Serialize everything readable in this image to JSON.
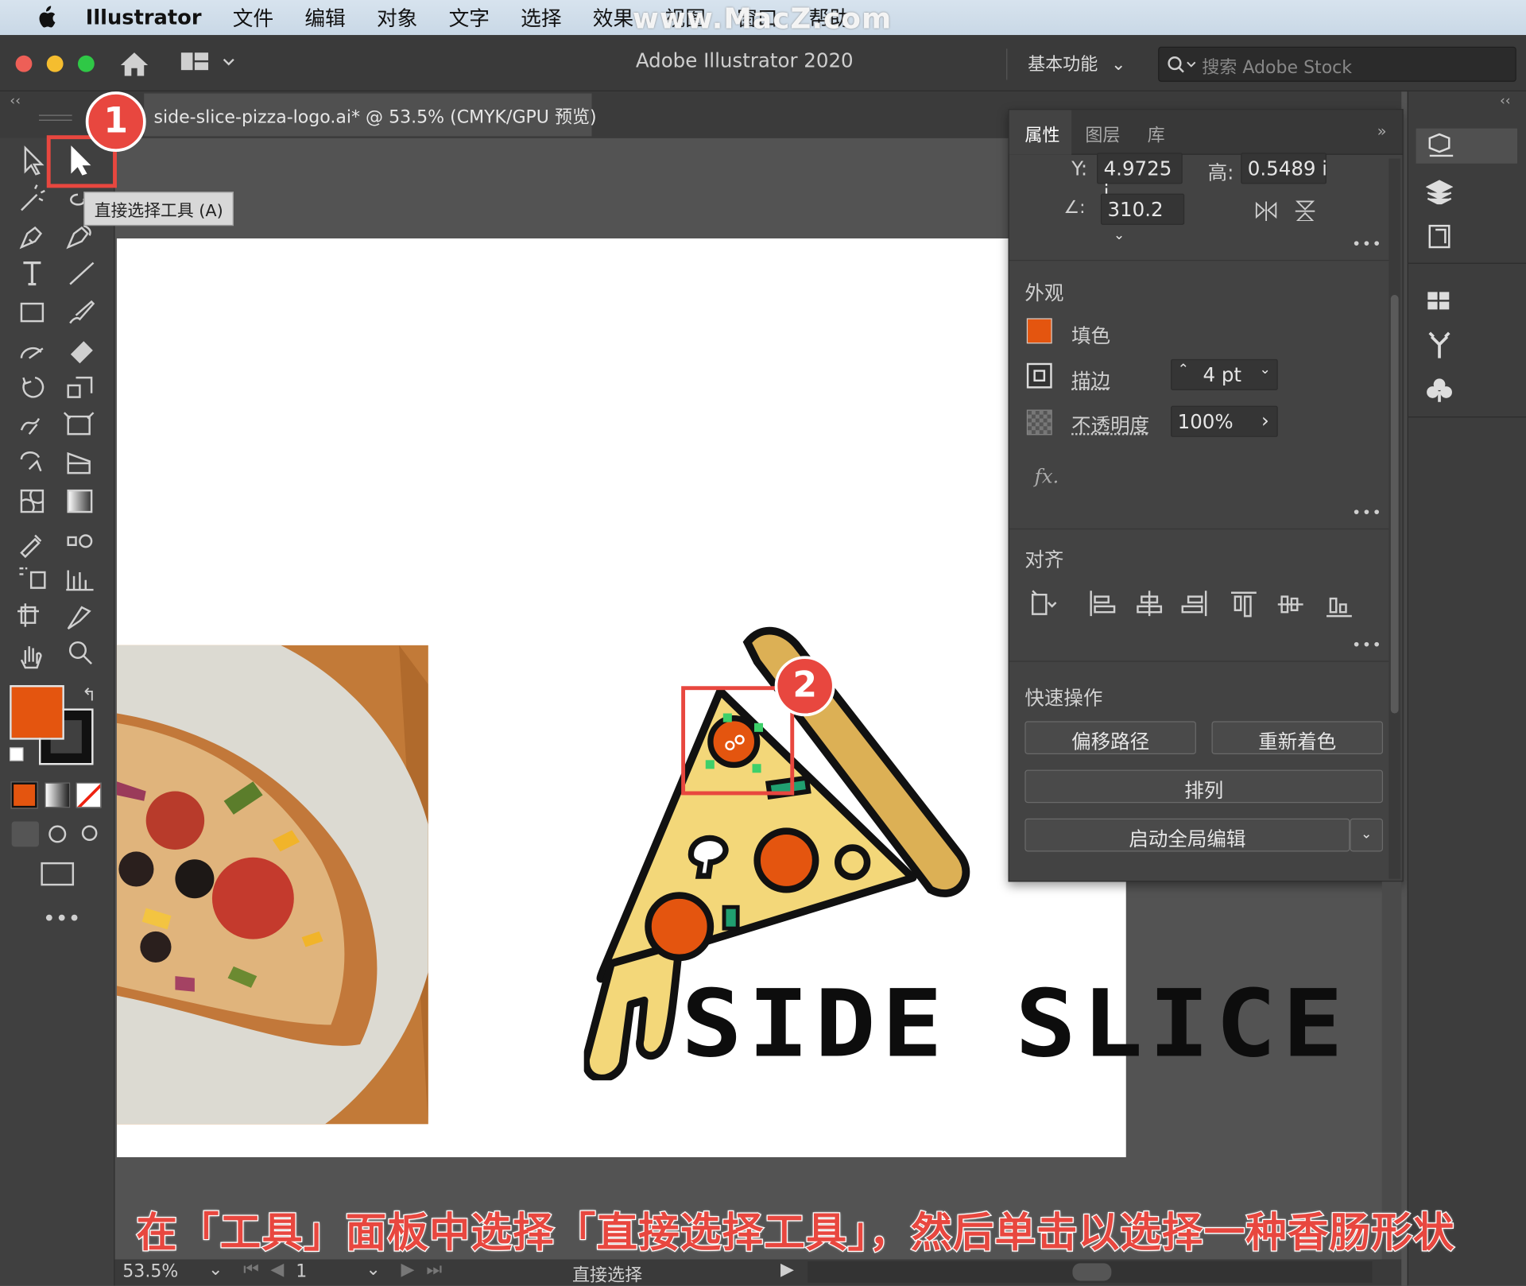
{
  "menubar": {
    "app_name": "Illustrator",
    "items": [
      "文件",
      "编辑",
      "对象",
      "文字",
      "选择",
      "效果",
      "视图",
      "窗口",
      "帮助"
    ],
    "watermark": "www.MacZ.com"
  },
  "titlebar": {
    "title": "Adobe Illustrator 2020",
    "workspace": "基本功能",
    "search_placeholder": "搜索 Adobe Stock"
  },
  "document_tab": {
    "label": "side-slice-pizza-logo.ai* @ 53.5% (CMYK/GPU 预览)"
  },
  "toolbar": {
    "tooltip": "直接选择工具 (A)",
    "tools": [
      "selection-tool",
      "direct-selection-tool",
      "magic-wand-tool",
      "lasso-tool",
      "pen-tool",
      "curvature-tool",
      "type-tool",
      "line-tool",
      "rectangle-tool",
      "paintbrush-tool",
      "shaper-tool",
      "eraser-tool",
      "rotate-tool",
      "scale-tool",
      "warp-tool",
      "free-transform-tool",
      "shape-builder-tool",
      "perspective-grid-tool",
      "mesh-tool",
      "gradient-tool",
      "eyedropper-tool",
      "blend-tool",
      "symbol-sprayer-tool",
      "column-graph-tool",
      "artboard-tool",
      "slice-tool",
      "hand-tool",
      "zoom-tool"
    ],
    "fill_color": "#e4550f",
    "stroke_color": "#111111",
    "more": "•••"
  },
  "properties": {
    "tabs": [
      "属性",
      "图层",
      "库"
    ],
    "transform": {
      "y_label": "Y:",
      "y_value": "4.9725 i",
      "h_label": "高:",
      "h_value": "0.5489 ir",
      "angle_label": "∠:",
      "angle_value": "310.2"
    },
    "appearance": {
      "title": "外观",
      "fill_label": "填色",
      "fill_color": "#e4550f",
      "stroke_label": "描边",
      "stroke_value": "4 pt",
      "opacity_label": "不透明度",
      "opacity_value": "100%",
      "fx": "fx."
    },
    "align": {
      "title": "对齐"
    },
    "quick_actions": {
      "title": "快速操作",
      "offset_path": "偏移路径",
      "recolor": "重新着色",
      "arrange": "排列",
      "global_edit": "启动全局编辑"
    },
    "more": "•••"
  },
  "artwork": {
    "logo_text": "SIDE SLICE",
    "crust_color": "#dcb055",
    "cheese_color": "#f3d779",
    "pepperoni_color": "#e4550f"
  },
  "statusbar": {
    "zoom": "53.5%",
    "artboard_number": "1",
    "tool_name": "直接选择"
  },
  "annotations": {
    "badge_1": "1",
    "badge_2": "2",
    "caption": "在「工具」面板中选择「直接选择工具」，然后单击以选择一种香肠形状"
  }
}
